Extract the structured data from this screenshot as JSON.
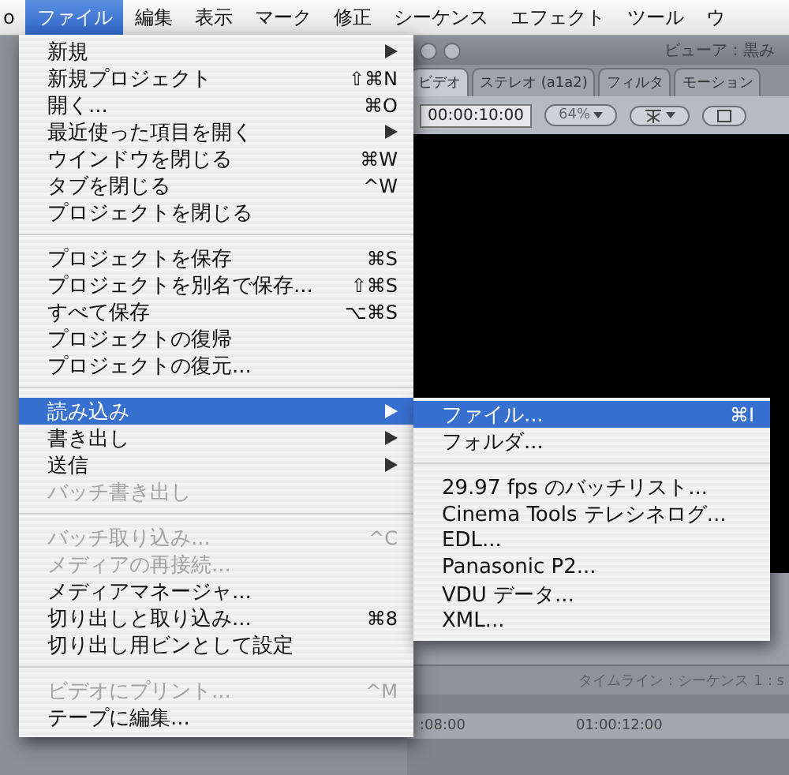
{
  "menubar": {
    "items": [
      {
        "label": "o",
        "selected": false
      },
      {
        "label": "ファイル",
        "selected": true
      },
      {
        "label": "編集",
        "selected": false
      },
      {
        "label": "表示",
        "selected": false
      },
      {
        "label": "マーク",
        "selected": false
      },
      {
        "label": "修正",
        "selected": false
      },
      {
        "label": "シーケンス",
        "selected": false
      },
      {
        "label": "エフェクト",
        "selected": false
      },
      {
        "label": "ツール",
        "selected": false
      },
      {
        "label": "ウ",
        "selected": false
      }
    ]
  },
  "file_menu": {
    "items": [
      {
        "kind": "item",
        "label": "新規",
        "submenu": true,
        "disabled": false,
        "selected": false
      },
      {
        "kind": "item",
        "label": "新規プロジェクト",
        "shortcut": "⇧⌘N",
        "disabled": false,
        "selected": false
      },
      {
        "kind": "item",
        "label": "開く...",
        "shortcut": "⌘O",
        "disabled": false,
        "selected": false
      },
      {
        "kind": "item",
        "label": "最近使った項目を開く",
        "submenu": true,
        "disabled": false,
        "selected": false
      },
      {
        "kind": "item",
        "label": "ウインドウを閉じる",
        "shortcut": "⌘W",
        "disabled": false,
        "selected": false
      },
      {
        "kind": "item",
        "label": "タブを閉じる",
        "shortcut": "^W",
        "disabled": false,
        "selected": false
      },
      {
        "kind": "item",
        "label": "プロジェクトを閉じる",
        "disabled": false,
        "selected": false
      },
      {
        "kind": "separator"
      },
      {
        "kind": "item",
        "label": "プロジェクトを保存",
        "shortcut": "⌘S",
        "disabled": false,
        "selected": false
      },
      {
        "kind": "item",
        "label": "プロジェクトを別名で保存...",
        "shortcut": "⇧⌘S",
        "disabled": false,
        "selected": false
      },
      {
        "kind": "item",
        "label": "すべて保存",
        "shortcut": "⌥⌘S",
        "disabled": false,
        "selected": false
      },
      {
        "kind": "item",
        "label": "プロジェクトの復帰",
        "disabled": false,
        "selected": false
      },
      {
        "kind": "item",
        "label": "プロジェクトの復元...",
        "disabled": false,
        "selected": false
      },
      {
        "kind": "separator"
      },
      {
        "kind": "item",
        "label": "読み込み",
        "submenu": true,
        "disabled": false,
        "selected": true
      },
      {
        "kind": "item",
        "label": "書き出し",
        "submenu": true,
        "disabled": false,
        "selected": false
      },
      {
        "kind": "item",
        "label": "送信",
        "submenu": true,
        "disabled": false,
        "selected": false
      },
      {
        "kind": "item",
        "label": "バッチ書き出し",
        "disabled": true,
        "selected": false
      },
      {
        "kind": "separator"
      },
      {
        "kind": "item",
        "label": "バッチ取り込み...",
        "shortcut": "^C",
        "disabled": true,
        "selected": false
      },
      {
        "kind": "item",
        "label": "メディアの再接続...",
        "disabled": true,
        "selected": false
      },
      {
        "kind": "item",
        "label": "メディアマネージャ...",
        "disabled": false,
        "selected": false
      },
      {
        "kind": "item",
        "label": "切り出しと取り込み...",
        "shortcut": "⌘8",
        "disabled": false,
        "selected": false
      },
      {
        "kind": "item",
        "label": "切り出し用ビンとして設定",
        "disabled": false,
        "selected": false
      },
      {
        "kind": "separator"
      },
      {
        "kind": "item",
        "label": "ビデオにプリント...",
        "shortcut": "^M",
        "disabled": true,
        "selected": false
      },
      {
        "kind": "item",
        "label": "テープに編集...",
        "disabled": false,
        "selected": false
      }
    ]
  },
  "import_submenu": {
    "items": [
      {
        "kind": "item",
        "label": "ファイル...",
        "shortcut": "⌘I",
        "selected": true
      },
      {
        "kind": "item",
        "label": "フォルダ...",
        "selected": false
      },
      {
        "kind": "separator"
      },
      {
        "kind": "item",
        "label": "29.97 fps のバッチリスト...",
        "selected": false
      },
      {
        "kind": "item",
        "label": "Cinema Tools テレシネログ...",
        "selected": false
      },
      {
        "kind": "item",
        "label": "EDL...",
        "selected": false
      },
      {
        "kind": "item",
        "label": "Panasonic P2...",
        "selected": false
      },
      {
        "kind": "item",
        "label": "VDU データ...",
        "selected": false
      },
      {
        "kind": "item",
        "label": "XML...",
        "selected": false
      }
    ]
  },
  "viewer": {
    "title": "ビューア：黒み",
    "tabs": [
      {
        "label": "ビデオ",
        "selected": true
      },
      {
        "label": "ステレオ (a1a2)",
        "selected": false
      },
      {
        "label": "フィルタ",
        "selected": false
      },
      {
        "label": "モーション",
        "selected": false
      }
    ],
    "timecode": "00:00:10:00",
    "zoom": "64%"
  },
  "timeline": {
    "title": "タイムライン：シーケンス 1：s",
    "ruler": [
      ":08:00",
      "01:00:12:00"
    ]
  }
}
